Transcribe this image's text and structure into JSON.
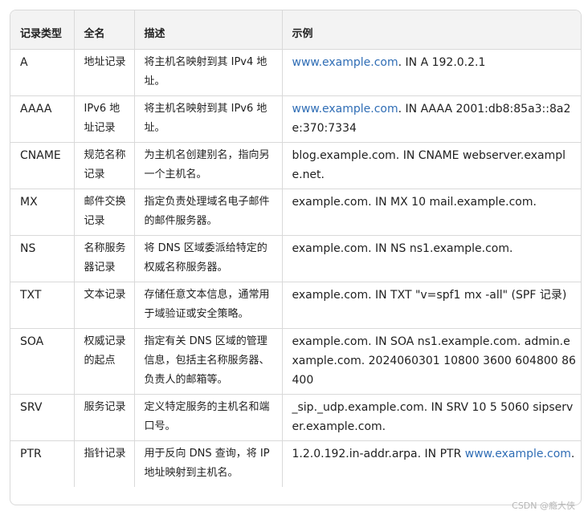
{
  "table": {
    "headers": [
      "记录类型",
      "全名",
      "描述",
      "示例"
    ],
    "rows": [
      {
        "type": "A",
        "name": "地址记录",
        "desc": "将主机名映射到其 IPv4 地址。",
        "example_link": "www.example.com",
        "example_rest": ". IN A 192.0.2.1",
        "link_first": true
      },
      {
        "type": "AAAA",
        "name": "IPv6 地址记录",
        "desc": "将主机名映射到其 IPv6 地址。",
        "example_link": "www.example.com",
        "example_rest": ". IN AAAA 2001:db8:85a3::8a2e:370:7334",
        "link_first": true
      },
      {
        "type": "CNAME",
        "name": "规范名称记录",
        "desc": "为主机名创建别名，指向另一个主机名。",
        "example_link": "",
        "example_rest": "blog.example.com. IN CNAME webserver.example.net.",
        "link_first": false
      },
      {
        "type": "MX",
        "name": "邮件交换记录",
        "desc": "指定负责处理域名电子邮件的邮件服务器。",
        "example_link": "",
        "example_rest": "example.com. IN MX 10 mail.example.com.",
        "link_first": false
      },
      {
        "type": "NS",
        "name": "名称服务器记录",
        "desc": "将 DNS 区域委派给特定的权威名称服务器。",
        "example_link": "",
        "example_rest": "example.com. IN NS ns1.example.com.",
        "link_first": false
      },
      {
        "type": "TXT",
        "name": "文本记录",
        "desc": "存储任意文本信息，通常用于域验证或安全策略。",
        "example_link": "",
        "example_rest": "example.com. IN TXT \"v=spf1 mx -all\" (SPF 记录)",
        "link_first": false
      },
      {
        "type": "SOA",
        "name": "权威记录的起点",
        "desc": "指定有关 DNS 区域的管理信息，包括主名称服务器、负责人的邮箱等。",
        "example_link": "",
        "example_rest": "example.com. IN SOA ns1.example.com. admin.example.com. 2024060301 10800 3600 604800 86400",
        "link_first": false
      },
      {
        "type": "SRV",
        "name": "服务记录",
        "desc": "定义特定服务的主机名和端口号。",
        "example_link": "",
        "example_rest": "_sip._udp.example.com. IN SRV 10 5 5060 sipserver.example.com.",
        "link_first": false
      },
      {
        "type": "PTR",
        "name": "指针记录",
        "desc": "用于反向 DNS 查询，将 IP 地址映射到主机名。",
        "example_prefix": "1.2.0.192.in-addr.arpa. IN PTR ",
        "example_link": "www.example.com",
        "example_rest": ".",
        "link_first": false
      }
    ]
  },
  "watermark": "CSDN @瘾大侠",
  "colors": {
    "link": "#2f6db5",
    "header_bg": "#f3f3f3",
    "border": "#d9d9d9"
  }
}
